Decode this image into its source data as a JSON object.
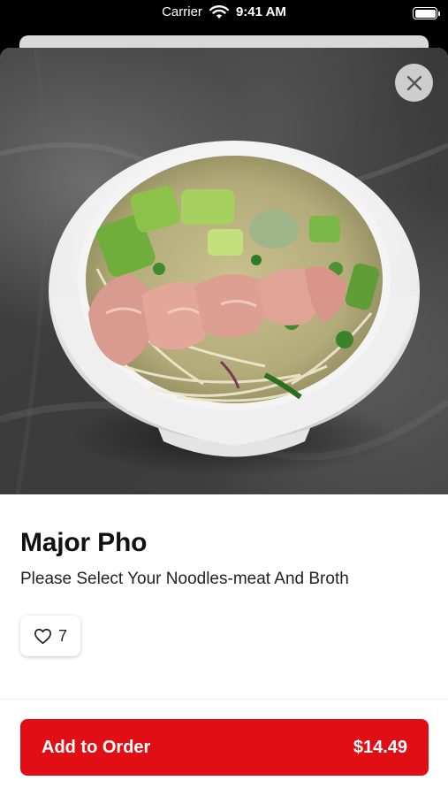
{
  "status_bar": {
    "carrier": "Carrier",
    "time": "9:41 AM"
  },
  "item": {
    "title": "Major Pho",
    "description": "Please Select Your Noodles-meat And Broth",
    "likes": "7"
  },
  "footer": {
    "add_label": "Add to Order",
    "price": "$14.49"
  },
  "colors": {
    "accent": "#e10f15",
    "background": "#ffffff"
  },
  "icons": {
    "close": "close-icon",
    "like": "heart-icon",
    "wifi": "wifi-icon",
    "battery": "battery-icon"
  }
}
